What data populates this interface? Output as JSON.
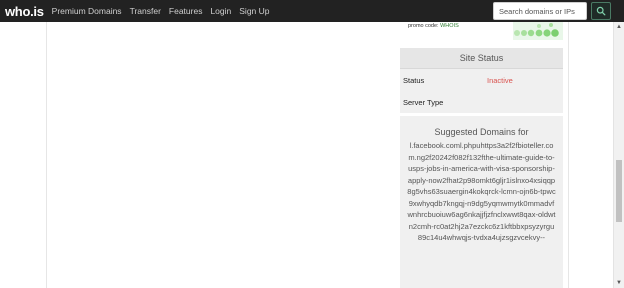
{
  "nav": {
    "logo": "who.is",
    "links": [
      "Premium Domains",
      "Transfer",
      "Features",
      "Login",
      "Sign Up"
    ],
    "search_placeholder": "Search domains or IPs"
  },
  "promo": {
    "label": "promo code:",
    "code": "WHOIS"
  },
  "site_status": {
    "title": "Site Status",
    "rows": [
      {
        "label": "Status",
        "value": "Inactive"
      },
      {
        "label": "Server Type",
        "value": ""
      }
    ]
  },
  "suggested": {
    "title": "Suggested Domains for",
    "domain": "l.facebook.coml.phpuhttps3a2f2fbioteller.com.ng2f20242f082f132fthe-ultimate-guide-to-usps-jobs-in-america-with-visa-sponsorship-apply-now2fhat2p98omkt6gljr1islnxo4xsiqqp8g5vhs63suaergin4kokqrck-lcmn-ojn6b-tpwc9xwhyqdb7kngqj-n9dg5yqmwmytk0mmadvfwnhrcbuoiuw6ag6nkajjfjzfnclxwwt8qax-oldwtn2cmh-rc0at2hj2a7ezckc6z1kftbbxpsyzyrgu89c14u4whwqjs-tvdxa4ujzsgzvcekvy--"
  },
  "colors": {
    "navbar": "#222222",
    "inactive": "#d9534f",
    "promo_code": "#2e7d32"
  }
}
